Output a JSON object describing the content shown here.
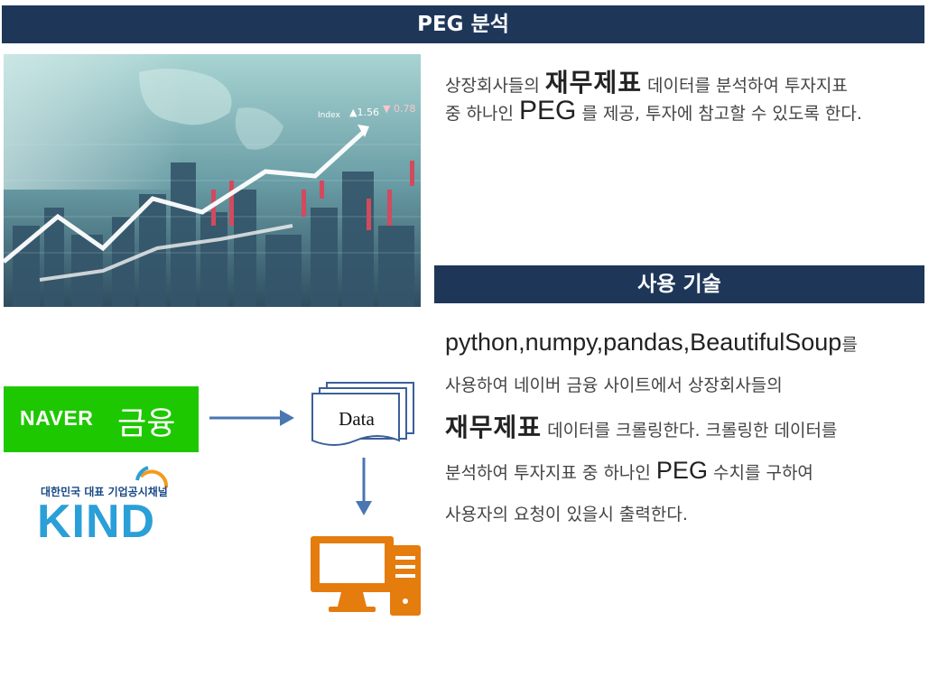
{
  "sections": {
    "peg_title": "PEG 분석",
    "tech_title": "사용 기술"
  },
  "hero": {
    "index_label": "Index",
    "up_value": "▲1.56",
    "down_value": "▼ 0.78"
  },
  "intro": {
    "line1_a": "상장회사들의 ",
    "line1_big": "재무제표",
    "line1_b": " 데이터를 분석하여 투자지표",
    "line2_a": "중 하나인 ",
    "line2_big": "PEG",
    "line2_b": " 를 제공, 투자에 참고할 수 있도록 한다."
  },
  "tech": {
    "libraries": "python,numpy,pandas,BeautifulSoup",
    "lib_suffix": "를",
    "line2": "사용하여 네이버 금융 사이트에서 상장회사들의",
    "line3_big": "재무제표",
    "line3_b": "  데이터를 크롤링한다. 크롤링한 데이터를",
    "line4_a": "분석하여 투자지표 중 하나인 ",
    "line4_big": "PEG",
    "line4_b": " 수치를 구하여",
    "line5": "사용자의 요청이 있을시 출력한다."
  },
  "diagram": {
    "naver_word": "NAVER",
    "naver_finance": "금융",
    "kind_subtitle": "대한민국 대표 기업공시채널",
    "kind_word": "KIND",
    "data_label": "Data"
  },
  "colors": {
    "banner": "#1e3759",
    "naver_green": "#1ec800",
    "kind_blue": "#2a9fd8",
    "arrow_blue": "#4a76b2",
    "computer_orange": "#e57c0e"
  }
}
